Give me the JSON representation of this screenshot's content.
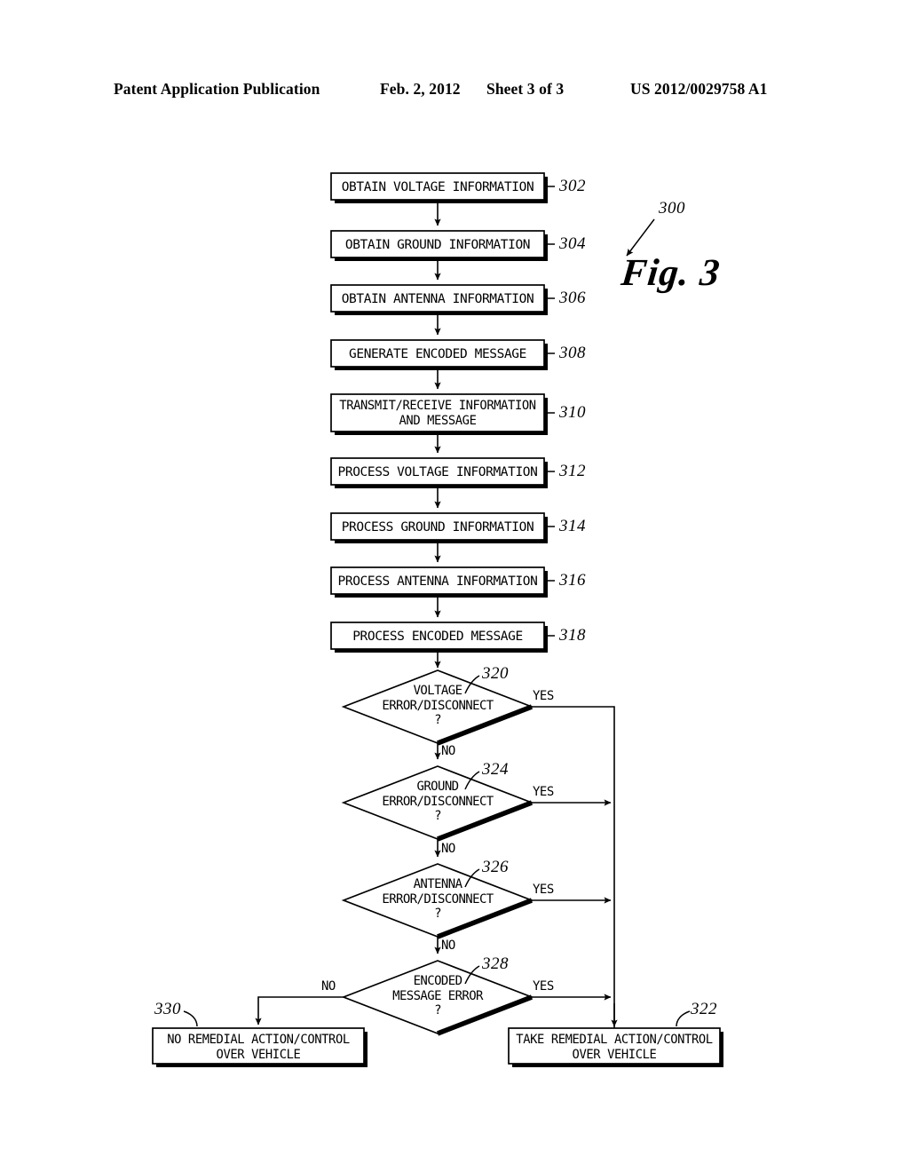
{
  "header": {
    "publication": "Patent Application Publication",
    "date": "Feb. 2, 2012",
    "sheet": "Sheet 3 of 3",
    "number": "US 2012/0029758 A1"
  },
  "figure": {
    "caption": "Fig. 3",
    "diagram_ref": "300",
    "type": "flowchart",
    "process_steps": [
      {
        "ref": "302",
        "text": "OBTAIN VOLTAGE INFORMATION"
      },
      {
        "ref": "304",
        "text": "OBTAIN GROUND INFORMATION"
      },
      {
        "ref": "306",
        "text": "OBTAIN ANTENNA INFORMATION"
      },
      {
        "ref": "308",
        "text": "GENERATE ENCODED MESSAGE"
      },
      {
        "ref": "310",
        "text": "TRANSMIT/RECEIVE INFORMATION\nAND MESSAGE"
      },
      {
        "ref": "312",
        "text": "PROCESS VOLTAGE INFORMATION"
      },
      {
        "ref": "314",
        "text": "PROCESS GROUND INFORMATION"
      },
      {
        "ref": "316",
        "text": "PROCESS ANTENNA INFORMATION"
      },
      {
        "ref": "318",
        "text": "PROCESS ENCODED MESSAGE"
      }
    ],
    "decisions": [
      {
        "ref": "320",
        "text": "VOLTAGE\nERROR/DISCONNECT\n?",
        "yes_label": "YES",
        "no_label": "NO"
      },
      {
        "ref": "324",
        "text": "GROUND\nERROR/DISCONNECT\n?",
        "yes_label": "YES",
        "no_label": "NO"
      },
      {
        "ref": "326",
        "text": "ANTENNA\nERROR/DISCONNECT\n?",
        "yes_label": "YES",
        "no_label": "NO"
      },
      {
        "ref": "328",
        "text": "ENCODED\nMESSAGE ERROR\n?",
        "yes_label": "YES",
        "no_label": "NO"
      }
    ],
    "terminals": [
      {
        "ref": "330",
        "text": "NO REMEDIAL ACTION/CONTROL\nOVER VEHICLE"
      },
      {
        "ref": "322",
        "text": "TAKE REMEDIAL ACTION/CONTROL\nOVER VEHICLE"
      }
    ],
    "colors": {
      "ink": "#000000",
      "paper": "#ffffff"
    }
  }
}
